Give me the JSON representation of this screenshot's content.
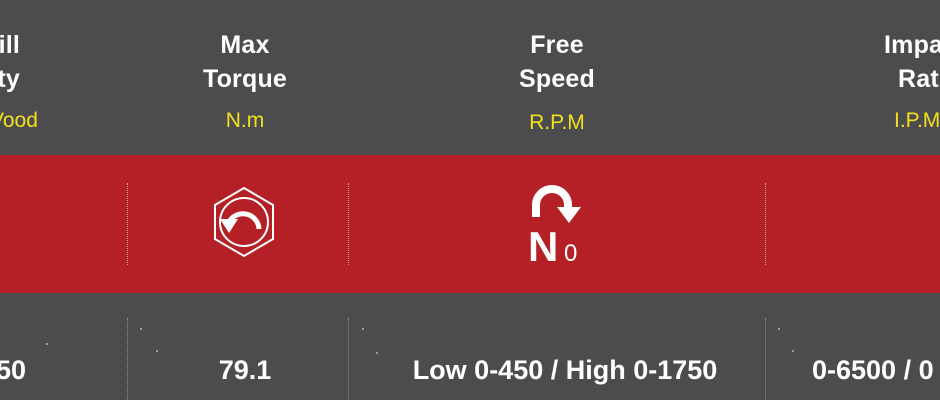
{
  "columns": [
    {
      "title_lines": [
        "ill",
        "ty"
      ],
      "unit": "Vood",
      "value": "50"
    },
    {
      "title_lines": [
        "Max",
        "Torque"
      ],
      "unit": "N.m",
      "value": "79.1",
      "icon": "torque-icon"
    },
    {
      "title_lines": [
        "Free",
        "Speed"
      ],
      "unit": "R.P.M",
      "value": "Low 0-450 / High 0-1750",
      "icon": "no-load-speed-icon"
    },
    {
      "title_lines": [
        "Impa",
        "Rat"
      ],
      "unit": "I.P.M",
      "value": "0-6500 / 0"
    }
  ],
  "icons": {
    "speed_icon_letter": "N",
    "speed_icon_subscript": "0"
  },
  "colors": {
    "background": "#4c4c4e",
    "band": "#b51f26",
    "unit_text": "#f2e01e",
    "text": "#ffffff"
  }
}
